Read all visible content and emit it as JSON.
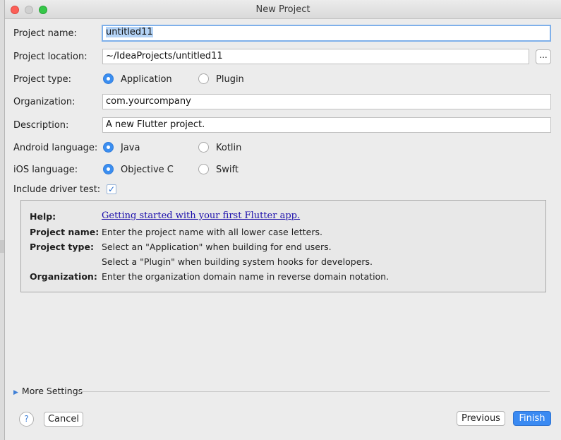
{
  "window": {
    "title": "New Project"
  },
  "form": {
    "project_name": {
      "label": "Project name:",
      "value": "untitled11"
    },
    "project_location": {
      "label": "Project location:",
      "value": "~/IdeaProjects/untitled11",
      "browse_label": "..."
    },
    "project_type": {
      "label": "Project type:",
      "options": [
        "Application",
        "Plugin"
      ],
      "selected": "Application"
    },
    "organization": {
      "label": "Organization:",
      "value": "com.yourcompany"
    },
    "description": {
      "label": "Description:",
      "value": "A new Flutter project."
    },
    "android_language": {
      "label": "Android language:",
      "options": [
        "Java",
        "Kotlin"
      ],
      "selected": "Java"
    },
    "ios_language": {
      "label": "iOS language:",
      "options": [
        "Objective C",
        "Swift"
      ],
      "selected": "Objective C"
    },
    "driver_test": {
      "label": "Include driver test:",
      "checked": true,
      "check_glyph": "✓"
    }
  },
  "help": {
    "help_key": "Help:",
    "help_link": "Getting started with your first Flutter app.",
    "project_name_key": "Project name:",
    "project_name_text": "Enter the project name with all lower case letters.",
    "project_type_key": "Project type:",
    "project_type_text_1": "Select an \"Application\" when building for end users.",
    "project_type_text_2": "Select a \"Plugin\" when building system hooks for developers.",
    "organization_key": "Organization:",
    "organization_text": "Enter the organization domain name in reverse domain notation."
  },
  "more_settings": {
    "label": "More Settings",
    "arrow": "▶"
  },
  "footer": {
    "help_glyph": "?",
    "cancel_label": "Cancel",
    "previous_label": "Previous",
    "finish_label": "Finish"
  },
  "colors": {
    "accent": "#3a8af2",
    "link": "#1a0dab",
    "selection": "#b4d3f6"
  }
}
